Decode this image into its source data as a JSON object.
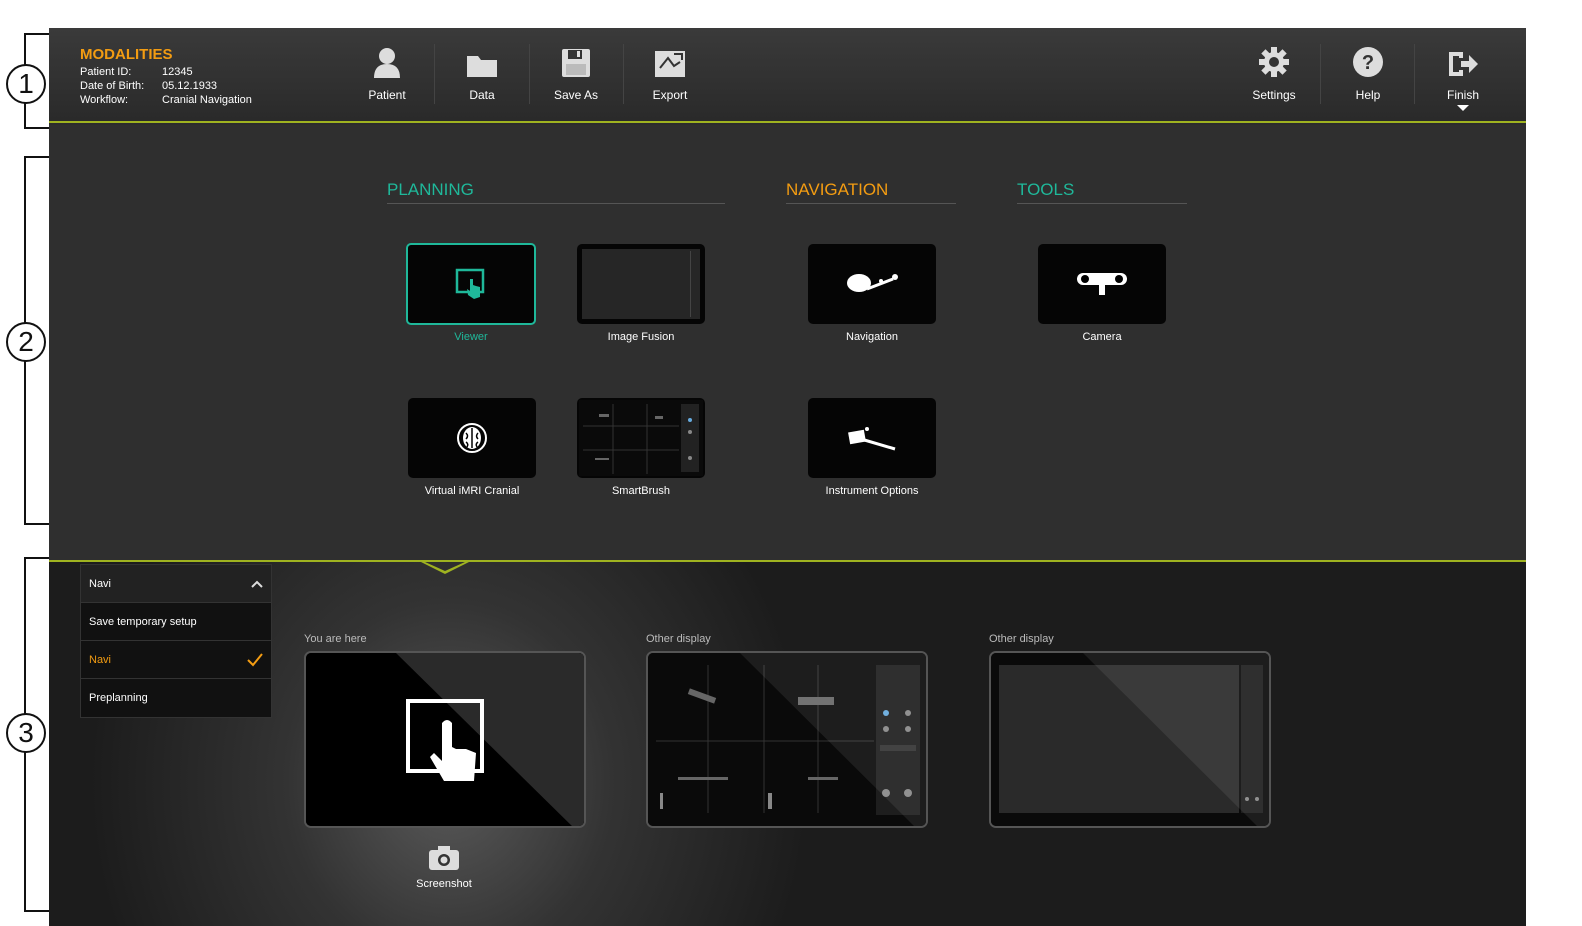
{
  "callouts": [
    "1",
    "2",
    "3"
  ],
  "header": {
    "title": "MODALITIES",
    "patient_id_label": "Patient ID:",
    "patient_id": "12345",
    "dob_label": "Date of Birth:",
    "dob": "05.12.1933",
    "workflow_label": "Workflow:",
    "workflow": "Cranial Navigation",
    "buttons": {
      "patient": "Patient",
      "data": "Data",
      "save_as": "Save As",
      "export": "Export",
      "settings": "Settings",
      "help": "Help",
      "finish": "Finish"
    }
  },
  "sections": {
    "planning": "PLANNING",
    "navigation": "NAVIGATION",
    "tools": "TOOLS"
  },
  "tiles": {
    "viewer": "Viewer",
    "image_fusion": "Image Fusion",
    "navigation": "Navigation",
    "camera": "Camera",
    "virtual_imri": "Virtual iMRI Cranial",
    "smartbrush": "SmartBrush",
    "instrument_options": "Instrument Options"
  },
  "dropdown": {
    "selected": "Navi",
    "items": [
      "Save temporary setup",
      "Navi",
      "Preplanning"
    ]
  },
  "displays": {
    "current_label": "You are here",
    "other1_label": "Other display",
    "other2_label": "Other display",
    "screenshot": "Screenshot"
  },
  "colors": {
    "accent_green": "#1fb89a",
    "accent_orange": "#f39c12",
    "divider_lime": "#9fb320"
  }
}
